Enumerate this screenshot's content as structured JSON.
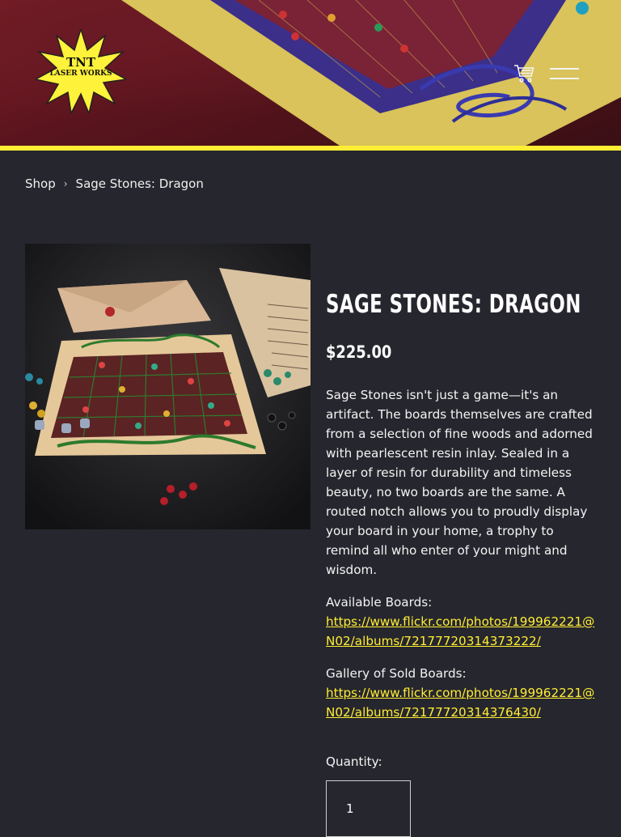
{
  "header": {
    "logo_line1": "TNT",
    "logo_line2": "LASER WORKS",
    "cart_icon": "cart-icon",
    "menu_icon": "hamburger-menu-icon",
    "accent_color": "#ffee33"
  },
  "breadcrumb": {
    "root": "Shop",
    "separator": "›",
    "current": "Sage Stones: Dragon"
  },
  "product": {
    "title": "Sage Stones: Dragon",
    "price": "$225.00",
    "description": "Sage Stones isn't just a game—it's an artifact. The boards themselves are crafted from a selection of fine woods and adorned with pearlescent resin inlay. Sealed in a layer of resin for durability and timeless beauty, no two boards are the same. A routed notch allows you to proudly display your board in your home, a trophy to remind all who enter of your might and wisdom.",
    "available_label": "Available Boards:",
    "available_link": "https://www.flickr.com/photos/199962221@N02/albums/72177720314373222/",
    "sold_label": "Gallery of Sold Boards:",
    "sold_link": "https://www.flickr.com/photos/199962221@N02/albums/72177720314376430/",
    "quantity_label": "Quantity:",
    "quantity_value": "1"
  }
}
